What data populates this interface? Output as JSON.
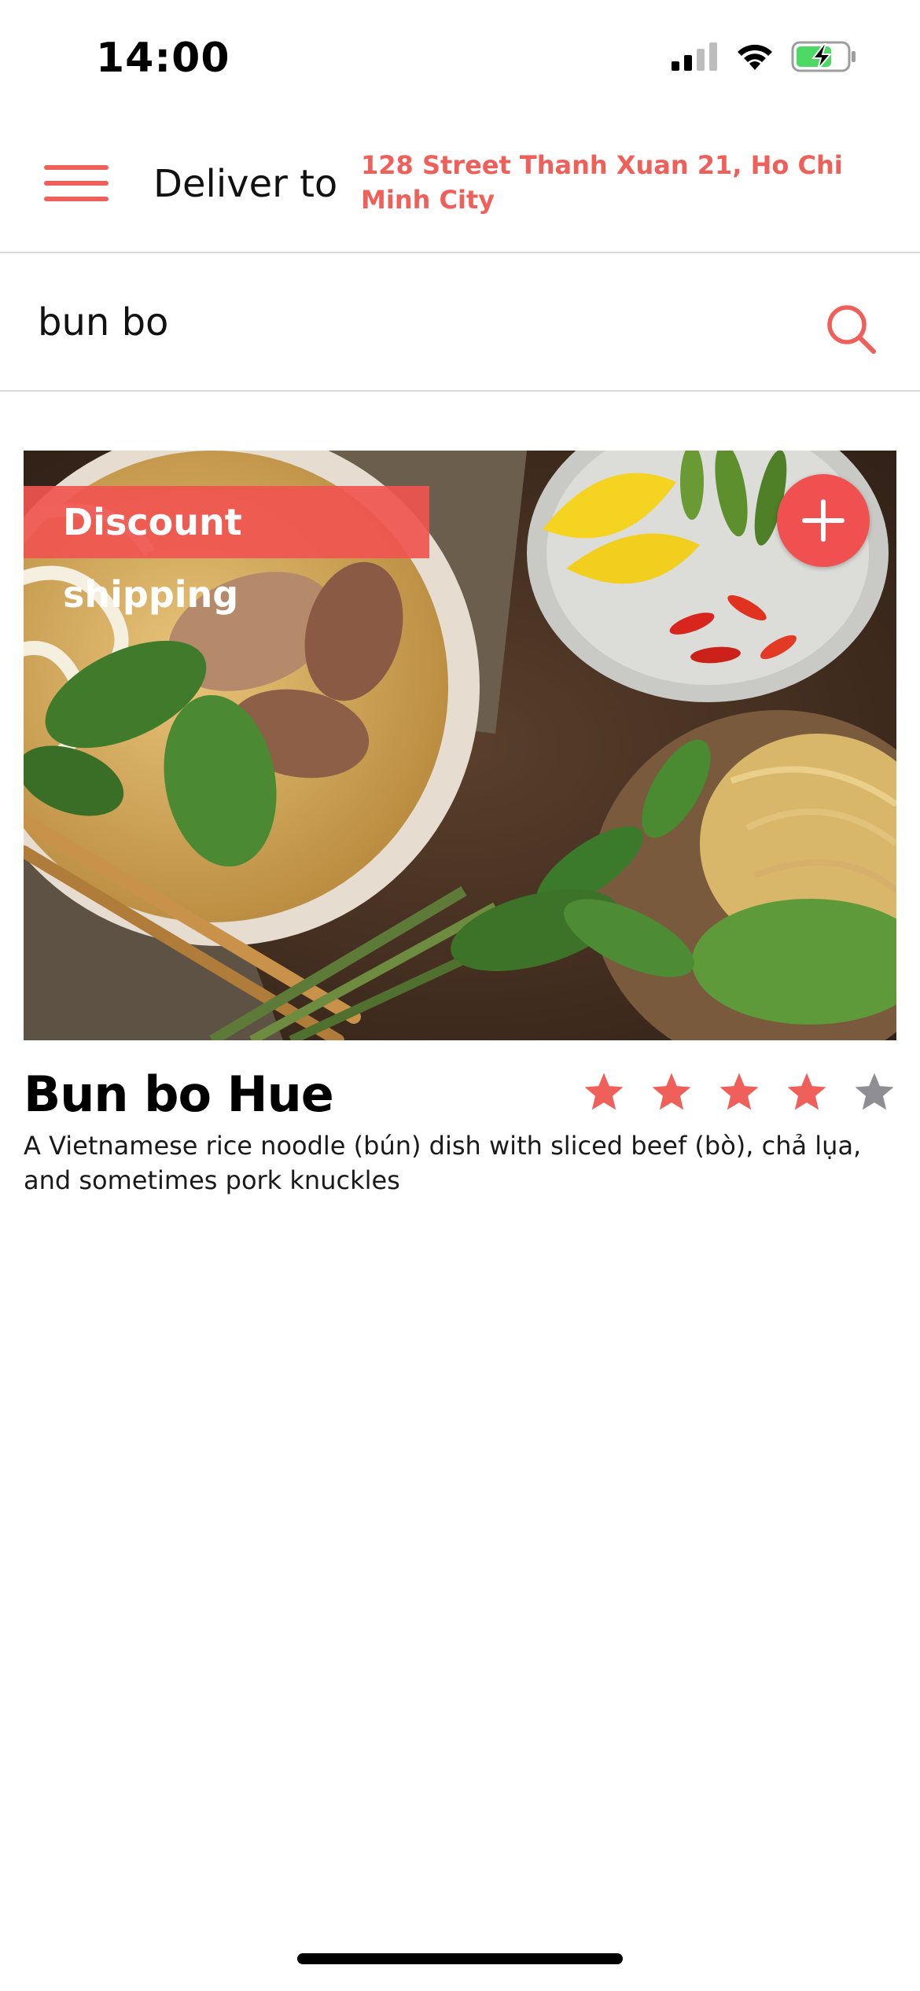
{
  "status_bar": {
    "time": "14:00",
    "icons": [
      "cellular-signal-icon",
      "wifi-icon",
      "battery-charging-icon"
    ]
  },
  "header": {
    "menu_icon": "hamburger-menu-icon",
    "deliver_label": "Deliver to",
    "address": "128 Street Thanh Xuan 21, Ho Chi Minh City"
  },
  "search": {
    "value": "bun bo",
    "icon": "search-icon"
  },
  "product": {
    "badge": "Discount shipping",
    "add_icon": "plus-icon",
    "title": "Bun bo Hue",
    "description": "A Vietnamese rice noodle (bún) dish with sliced beef (bò), chả lụa, and sometimes pork knuckles",
    "rating": 4,
    "rating_max": 5
  },
  "colors": {
    "accent": "#f0605a",
    "star_filled": "#f0605a",
    "star_empty": "#8e8e93",
    "divider": "#d9d9d9"
  }
}
